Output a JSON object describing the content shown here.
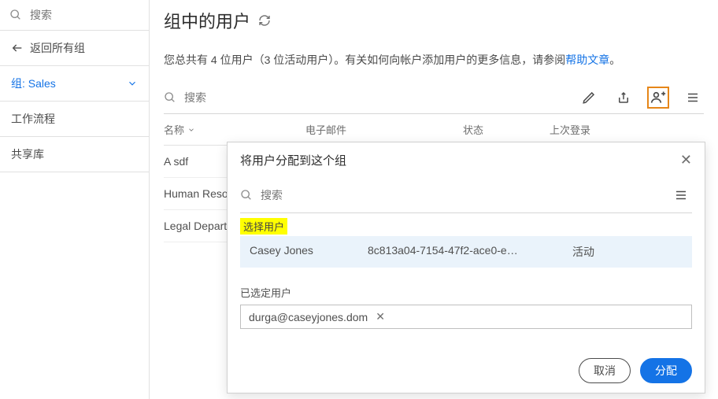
{
  "sidebar": {
    "search_placeholder": "搜索",
    "back_label": "返回所有组",
    "group_label": "组: Sales",
    "items": [
      "工作流程",
      "共享库"
    ]
  },
  "main": {
    "title": "组中的用户",
    "desc_prefix": "您总共有 4 位用户（3 位活动用户）。有关如何向帐户添加用户的更多信息，请参阅",
    "help_link": "帮助文章",
    "desc_suffix": "。",
    "toolbar_search_placeholder": "搜索",
    "columns": {
      "name": "名称",
      "email": "电子邮件",
      "status": "状态",
      "login": "上次登录"
    },
    "rows": [
      "A sdf",
      "Human Resou",
      "Legal Departm"
    ]
  },
  "dialog": {
    "title": "将用户分配到这个组",
    "search_placeholder": "搜索",
    "select_user_label": "选择用户",
    "candidate": {
      "name": "Casey Jones",
      "id": "8c813a04-7154-47f2-ace0-e…",
      "status": "活动"
    },
    "selected_label": "已选定用户",
    "chip_label": "durga@caseyjones.dom",
    "cancel": "取消",
    "assign": "分配"
  }
}
